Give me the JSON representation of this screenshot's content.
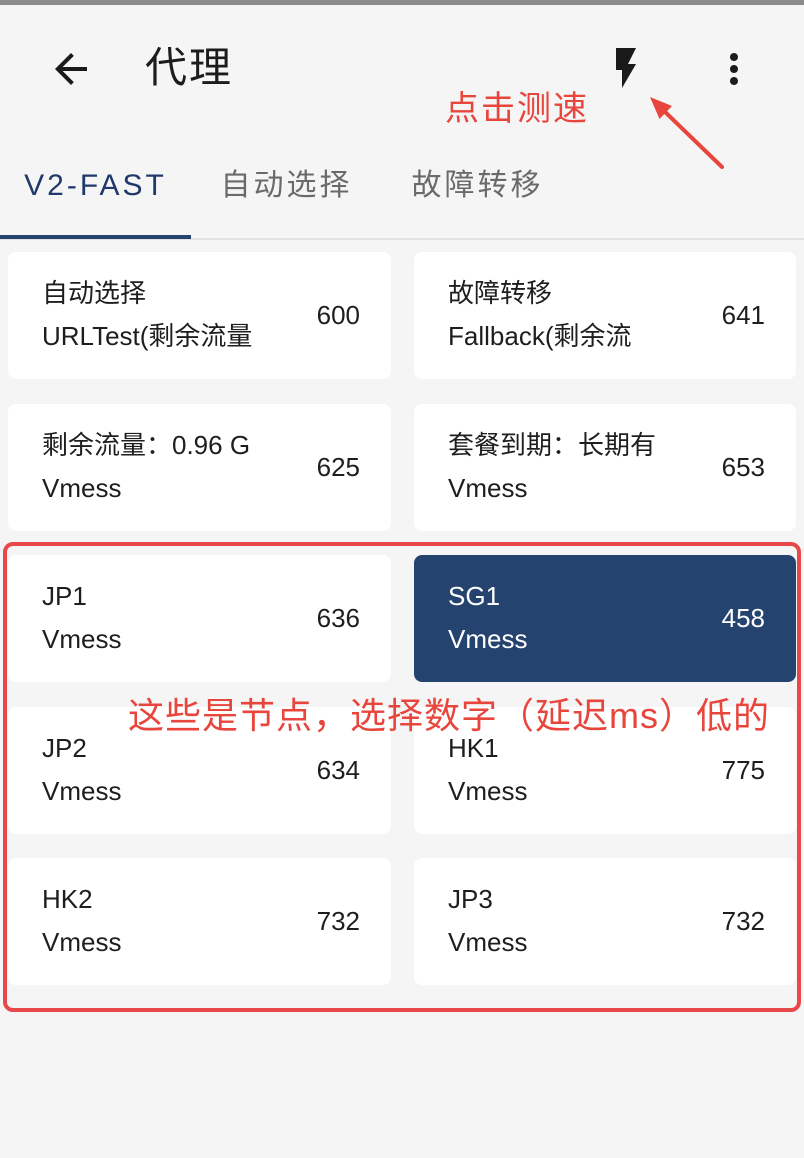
{
  "app_bar": {
    "title": "代理",
    "back_icon": "arrow-back-icon",
    "speed_test_icon": "flash-icon",
    "menu_icon": "more-vert-icon"
  },
  "tabs": {
    "items": [
      {
        "label": "V2-FAST",
        "active": true
      },
      {
        "label": "自动选择",
        "active": false
      },
      {
        "label": "故障转移",
        "active": false
      }
    ]
  },
  "proxies": [
    {
      "name": "自动选择",
      "type": "URLTest(剩余流量",
      "delay": 600,
      "selected": false
    },
    {
      "name": "故障转移",
      "type": "Fallback(剩余流",
      "delay": 641,
      "selected": false
    },
    {
      "name": "剩余流量：0.96 G",
      "type": "Vmess",
      "delay": 625,
      "selected": false
    },
    {
      "name": "套餐到期：长期有",
      "type": "Vmess",
      "delay": 653,
      "selected": false
    },
    {
      "name": "JP1",
      "type": "Vmess",
      "delay": 636,
      "selected": false
    },
    {
      "name": "SG1",
      "type": "Vmess",
      "delay": 458,
      "selected": true
    },
    {
      "name": "JP2",
      "type": "Vmess",
      "delay": 634,
      "selected": false
    },
    {
      "name": "HK1",
      "type": "Vmess",
      "delay": 775,
      "selected": false
    },
    {
      "name": "HK2",
      "type": "Vmess",
      "delay": 732,
      "selected": false
    },
    {
      "name": "JP3",
      "type": "Vmess",
      "delay": 732,
      "selected": false
    }
  ],
  "annotations": {
    "speed_test_hint": "点击测速",
    "nodes_hint": "这些是节点，选择数字（延迟ms）低的"
  },
  "colors": {
    "primary": "#25436f",
    "primary_text": "#1f3a6a",
    "annotation": "#e8453c",
    "annotation_frame": "#e8484a",
    "background": "#f5f5f5",
    "card": "#ffffff",
    "selected_text": "#ffffff"
  }
}
